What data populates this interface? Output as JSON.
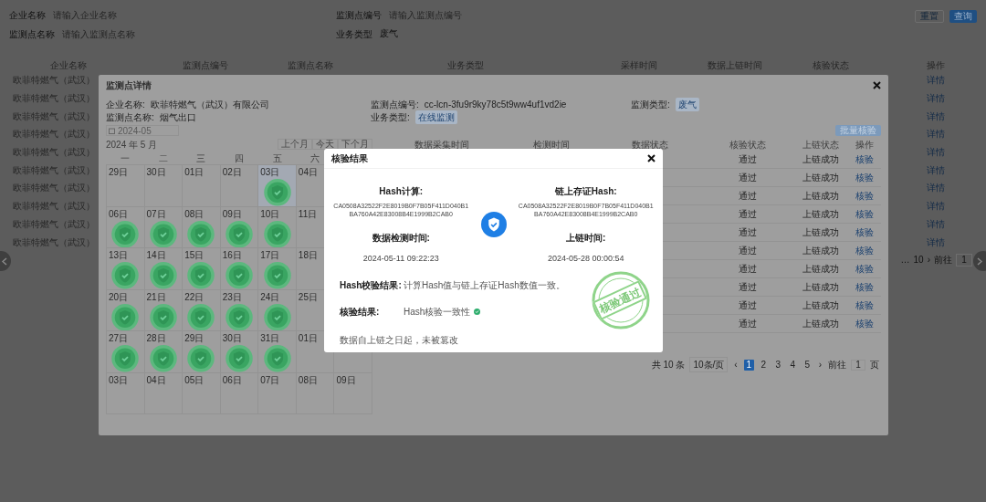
{
  "page": {
    "filters": [
      {
        "label": "企业名称",
        "placeholder": "请输入企业名称"
      },
      {
        "label": "监测点编号",
        "placeholder": "请输入监测点编号"
      },
      {
        "label": "监测点名称",
        "placeholder": "请输入监测点名称"
      },
      {
        "label": "业务类型",
        "value": "废气"
      }
    ],
    "buttons": [
      {
        "label": "重置",
        "kind": "default"
      },
      {
        "label": "查询",
        "kind": "primary"
      }
    ],
    "table": {
      "columns": [
        "企业名称",
        "监测点编号",
        "监测点名称",
        "业务类型",
        "采样时间",
        "数据上链时间",
        "核验状态",
        "操作"
      ],
      "rows": [
        {
          "enterprise": "欧菲特燃气（武汉）",
          "action": "详情"
        },
        {
          "enterprise": "欧菲特燃气（武汉）",
          "action": "详情"
        },
        {
          "enterprise": "欧菲特燃气（武汉）",
          "action": "详情"
        },
        {
          "enterprise": "欧菲特燃气（武汉）",
          "action": "详情"
        },
        {
          "enterprise": "欧菲特燃气（武汉）",
          "action": "详情"
        },
        {
          "enterprise": "欧菲特燃气（武汉）",
          "action": "详情"
        },
        {
          "enterprise": "欧菲特燃气（武汉）",
          "action": "详情"
        },
        {
          "enterprise": "欧菲特燃气（武汉）",
          "action": "详情"
        },
        {
          "enterprise": "欧菲特燃气（武汉）",
          "action": "详情"
        },
        {
          "enterprise": "欧菲特燃气（武汉）",
          "action": "详情"
        }
      ]
    },
    "pagination": {
      "items": [
        "…",
        "10",
        "›"
      ],
      "goto_label": "前往",
      "goto_value": "1"
    }
  },
  "detail_dialog": {
    "title": "监测点详情",
    "info": [
      {
        "label": "企业名称:",
        "value": "欧菲特燃气（武汉）有限公司",
        "kind": "text"
      },
      {
        "label": "监测点编号:",
        "value": "cc-lcn-3fu9r9ky78c5t9ww4uf1vd2ie",
        "kind": "text"
      },
      {
        "label": "监测类型:",
        "value": "废气",
        "kind": "tag"
      },
      {
        "label": "监测点名称:",
        "value": "烟气出口",
        "kind": "text"
      },
      {
        "label": "业务类型:",
        "value": "在线监测",
        "kind": "tag"
      }
    ],
    "month_picker": "2024-05",
    "calendar": {
      "title": "2024 年 5 月",
      "nav": [
        "上个月",
        "今天",
        "下个月"
      ],
      "weekdays": [
        "一",
        "二",
        "三",
        "四",
        "五",
        "六"
      ],
      "weeks": [
        [
          {
            "day": "29日",
            "verified": false,
            "selected": false
          },
          {
            "day": "30日",
            "verified": false,
            "selected": false
          },
          {
            "day": "01日",
            "verified": false,
            "selected": false
          },
          {
            "day": "02日",
            "verified": false,
            "selected": false
          },
          {
            "day": "03日",
            "verified": true,
            "selected": true
          },
          {
            "day": "04日",
            "verified": false,
            "selected": false
          }
        ],
        [
          {
            "day": "06日",
            "verified": true,
            "selected": false
          },
          {
            "day": "07日",
            "verified": true,
            "selected": false
          },
          {
            "day": "08日",
            "verified": true,
            "selected": false
          },
          {
            "day": "09日",
            "verified": true,
            "selected": false
          },
          {
            "day": "10日",
            "verified": true,
            "selected": false
          },
          {
            "day": "11日",
            "verified": false,
            "selected": false
          }
        ],
        [
          {
            "day": "13日",
            "verified": true,
            "selected": false
          },
          {
            "day": "14日",
            "verified": true,
            "selected": false
          },
          {
            "day": "15日",
            "verified": true,
            "selected": false
          },
          {
            "day": "16日",
            "verified": true,
            "selected": false
          },
          {
            "day": "17日",
            "verified": true,
            "selected": false
          },
          {
            "day": "18日",
            "verified": false,
            "selected": false
          }
        ],
        [
          {
            "day": "20日",
            "verified": true,
            "selected": false
          },
          {
            "day": "21日",
            "verified": true,
            "selected": false
          },
          {
            "day": "22日",
            "verified": true,
            "selected": false
          },
          {
            "day": "23日",
            "verified": true,
            "selected": false
          },
          {
            "day": "24日",
            "verified": true,
            "selected": false
          },
          {
            "day": "25日",
            "verified": false,
            "selected": false
          }
        ],
        [
          {
            "day": "27日",
            "verified": true,
            "selected": false
          },
          {
            "day": "28日",
            "verified": true,
            "selected": false
          },
          {
            "day": "29日",
            "verified": true,
            "selected": false
          },
          {
            "day": "30日",
            "verified": true,
            "selected": false
          },
          {
            "day": "31日",
            "verified": true,
            "selected": false
          },
          {
            "day": "01日",
            "verified": false,
            "selected": false
          }
        ],
        [
          {
            "day": "03日",
            "verified": false,
            "selected": false
          },
          {
            "day": "04日",
            "verified": false,
            "selected": false
          },
          {
            "day": "05日",
            "verified": false,
            "selected": false
          },
          {
            "day": "06日",
            "verified": false,
            "selected": false
          },
          {
            "day": "07日",
            "verified": false,
            "selected": false
          },
          {
            "day": "08日",
            "verified": false,
            "selected": false
          },
          {
            "day": "09日",
            "verified": false,
            "selected": false
          }
        ]
      ]
    },
    "batch_button": "批量核验",
    "table": {
      "columns": [
        "数据采集时间",
        "检测时间",
        "数据状态",
        "核验状态",
        "上链状态",
        "操作"
      ],
      "rows": [
        {
          "verify_status": "通过",
          "chain_status": "上链成功",
          "action": "核验"
        },
        {
          "verify_status": "通过",
          "chain_status": "上链成功",
          "action": "核验"
        },
        {
          "verify_status": "通过",
          "chain_status": "上链成功",
          "action": "核验"
        },
        {
          "verify_status": "通过",
          "chain_status": "上链成功",
          "action": "核验"
        },
        {
          "verify_status": "通过",
          "chain_status": "上链成功",
          "action": "核验"
        },
        {
          "verify_status": "通过",
          "chain_status": "上链成功",
          "action": "核验"
        },
        {
          "verify_status": "通过",
          "chain_status": "上链成功",
          "action": "核验"
        },
        {
          "verify_status": "通过",
          "chain_status": "上链成功",
          "action": "核验"
        },
        {
          "verify_status": "通过",
          "chain_status": "上链成功",
          "action": "核验"
        },
        {
          "verify_status": "通过",
          "chain_status": "上链成功",
          "action": "核验"
        }
      ]
    },
    "pagination": {
      "total": "共 10 条",
      "page_size": "10条/页",
      "prev": "‹",
      "pages": [
        {
          "label": "1",
          "selected": true
        },
        {
          "label": "2",
          "selected": false
        },
        {
          "label": "3",
          "selected": false
        },
        {
          "label": "4",
          "selected": false
        },
        {
          "label": "5",
          "selected": false
        }
      ],
      "next": "›",
      "goto_label": "前往",
      "goto_value": "1",
      "goto_suffix": "页"
    }
  },
  "result_dialog": {
    "title": "核验结果",
    "left": [
      {
        "label": "Hash计算:",
        "value": "CA0508A32522F2E8019B0F7B05F411D040B1BA760A42E83008B4E1999B2CAB0",
        "kind": "hash"
      },
      {
        "label": "数据检测时间:",
        "value": "2024-05-11 09:22:23",
        "kind": "time"
      }
    ],
    "right": [
      {
        "label": "链上存证Hash:",
        "value": "CA0508A32522F2E8019B0F7B05F411D040B1BA760A42E83008B4E1999B2CAB0",
        "kind": "hash"
      },
      {
        "label": "上链时间:",
        "value": "2024-05-28 00:00:54",
        "kind": "time"
      }
    ],
    "results": [
      {
        "label": "Hash校验结果:",
        "value": "计算Hash值与链上存证Hash数值一致。"
      },
      {
        "label": "核验结果:",
        "value": "Hash核验一致性",
        "passed": true
      }
    ],
    "stamp": "核验通过",
    "footer": "数据自上链之日起，未被篡改"
  }
}
